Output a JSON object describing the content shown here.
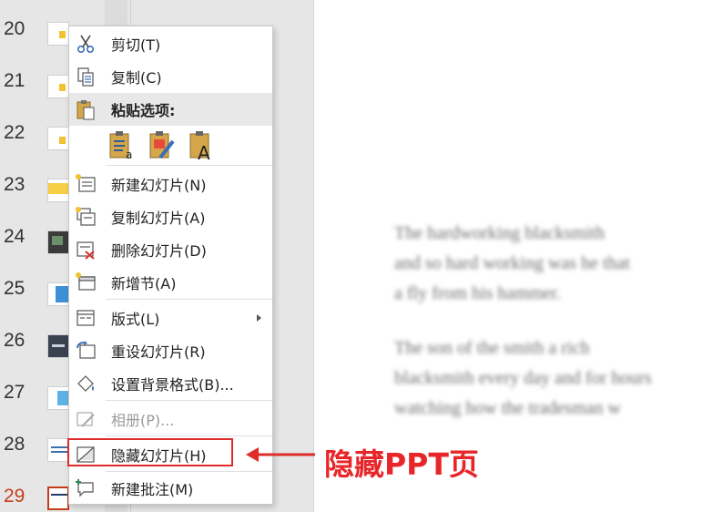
{
  "thumbnails": [
    {
      "num": "20"
    },
    {
      "num": "21"
    },
    {
      "num": "22"
    },
    {
      "num": "23"
    },
    {
      "num": "24"
    },
    {
      "num": "25"
    },
    {
      "num": "26"
    },
    {
      "num": "27"
    },
    {
      "num": "28"
    },
    {
      "num": "29"
    }
  ],
  "editor": {
    "lines": [
      "The hardworking blacksmith",
      "and so hard working was he that",
      "a fly from his hammer.",
      "The son of the smith a rich",
      "blacksmith every day and for hours",
      "watching how the tradesman w"
    ]
  },
  "menu": {
    "cut": "剪切(T)",
    "copy": "复制(C)",
    "paste_options": "粘贴选项:",
    "new_slide": "新建幻灯片(N)",
    "duplicate_slide": "复制幻灯片(A)",
    "delete_slide": "删除幻灯片(D)",
    "add_section": "新增节(A)",
    "layout": "版式(L)",
    "reset_slide": "重设幻灯片(R)",
    "format_background": "设置背景格式(B)...",
    "photo_album": "相册(P)...",
    "hide_slide": "隐藏幻灯片(H)",
    "new_comment": "新建批注(M)"
  },
  "annotation": "隐藏PPT页",
  "colors": {
    "accent_red": "#e02b2b",
    "current_slide": "#c43e1c"
  }
}
